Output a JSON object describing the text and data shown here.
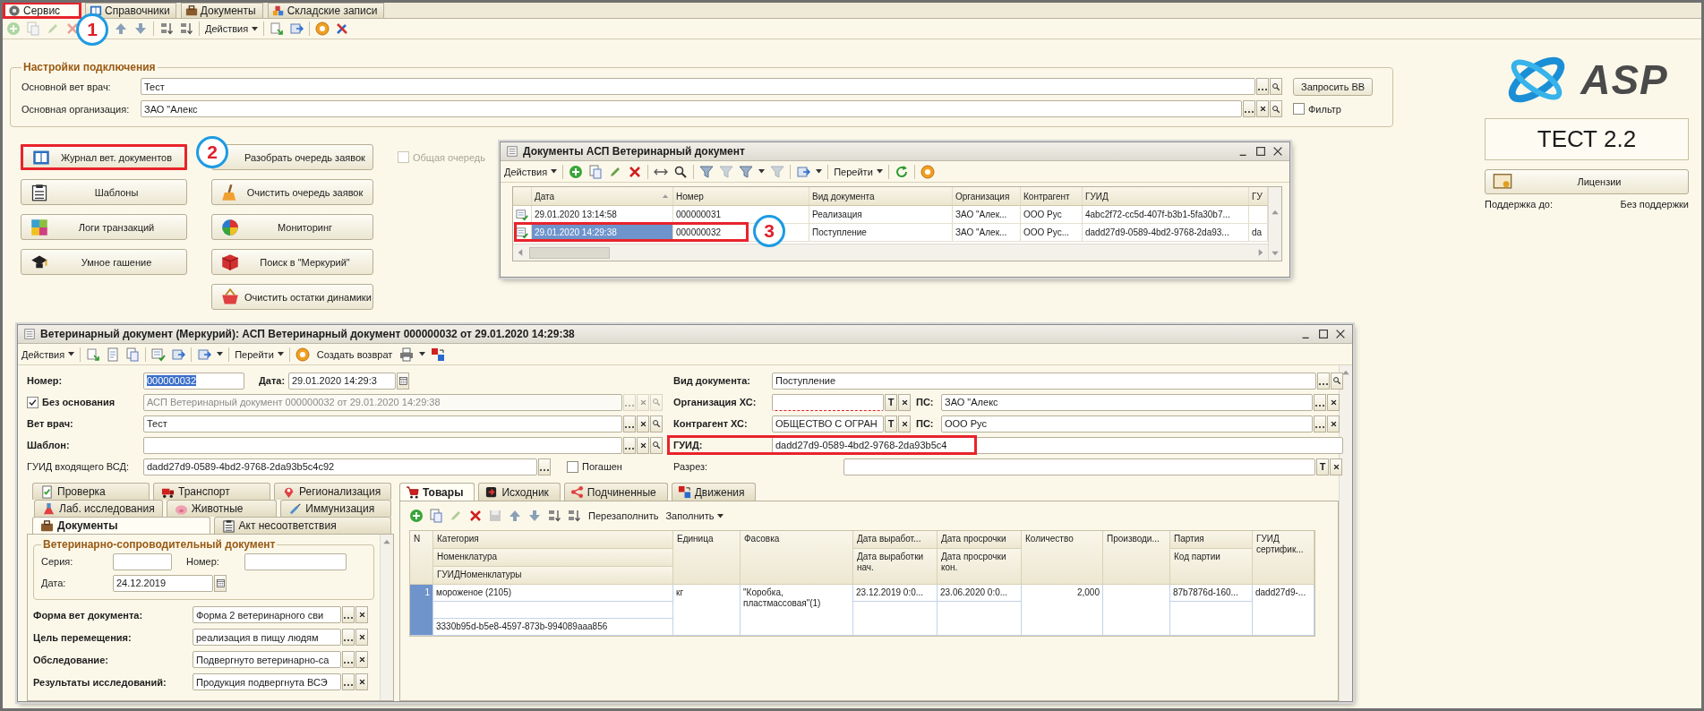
{
  "app_tabs": [
    {
      "label": "Сервис",
      "selected": true,
      "highlighted": true
    },
    {
      "label": "Справочники",
      "selected": false,
      "highlighted": false
    },
    {
      "label": "Документы",
      "selected": false,
      "highlighted": false
    },
    {
      "label": "Складские записи",
      "selected": false,
      "highlighted": false
    }
  ],
  "toolbar": {
    "actions_menu": "Действия"
  },
  "connection_settings": {
    "title": "Настройки подключения",
    "fields": [
      {
        "label": "Основной вет врач:",
        "value": "Тест"
      },
      {
        "label": "Основная организация:",
        "value": "ЗАО \"Алекс"
      }
    ],
    "request_button": "Запросить ВВ",
    "filter": {
      "label": "Фильтр",
      "checked": false
    }
  },
  "service_buttons": [
    {
      "label": "Журнал вет. документов",
      "highlighted": true
    },
    {
      "label": "Шаблоны",
      "highlighted": false
    },
    {
      "label": "Логи транзакций",
      "highlighted": false
    },
    {
      "label": "Умное гашение",
      "highlighted": false
    }
  ],
  "queue_buttons": [
    {
      "label": "Разобрать очередь заявок"
    },
    {
      "label": "Очистить очередь заявок"
    },
    {
      "label": "Мониторинг"
    },
    {
      "label": "Поиск в \"Меркурий\""
    },
    {
      "label": "Очистить остатки динамики"
    }
  ],
  "common_queue": {
    "label": "Общая очередь",
    "checked": false,
    "disabled": true
  },
  "brand": {
    "logo_text": "ASP",
    "edition": "ТЕСТ 2.2",
    "licenses_button": "Лицензии",
    "support_label": "Поддержка до:",
    "support_value": "Без поддержки"
  },
  "docs_window": {
    "title": "Документы АСП Ветеринарный документ",
    "actions_menu": "Действия",
    "goto_menu": "Перейти",
    "columns": [
      "Дата",
      "Номер",
      "Вид документа",
      "Организация",
      "Контрагент",
      "ГУИД",
      "ГУ"
    ],
    "rows": [
      {
        "cells": [
          "29.01.2020 13:14:58",
          "000000031",
          "Реализация",
          "ЗАО \"Алек...",
          "ООО Рус",
          "4abc2f72-cc5d-407f-b3b1-5fa30b7..."
        ],
        "selected": false,
        "highlighted": false
      },
      {
        "cells": [
          "29.01.2020 14:29:38",
          "000000032",
          "Поступление",
          "ЗАО \"Алек...",
          "ООО Рус...",
          "dadd27d9-0589-4bd2-9768-2da93...",
          "da"
        ],
        "selected": true,
        "highlighted": true
      }
    ]
  },
  "markers": [
    "1",
    "2",
    "3"
  ],
  "vet_window": {
    "title": "Ветеринарный документ (Меркурий): АСП Ветеринарный документ 000000032 от 29.01.2020 14:29:38",
    "actions_menu": "Действия",
    "goto_menu": "Перейти",
    "return_button": "Создать возврат",
    "header": {
      "number": {
        "label": "Номер:",
        "value": "000000032"
      },
      "date": {
        "label": "Дата:",
        "value": "29.01.2020 14:29:3"
      },
      "no_basis": {
        "label": "Без основания",
        "checked": true,
        "value": "АСП Ветеринарный документ 000000032 от 29.01.2020 14:29:38"
      },
      "vet": {
        "label": "Вет врач:",
        "value": "Тест"
      },
      "template": {
        "label": "Шаблон:"
      },
      "incoming_guid": {
        "label": "ГУИД входящего ВСД:",
        "value": "dadd27d9-0589-4bd2-9768-2da93b5c4c92"
      },
      "redeemed": {
        "label": "Погашен",
        "checked": false
      },
      "doc_type": {
        "label": "Вид документа:",
        "value": "Поступление"
      },
      "org": {
        "label": "Организация ХС:",
        "type_button": "T",
        "required": true
      },
      "org_ps": {
        "label": "ПС:",
        "value": "ЗАО \"Алекс"
      },
      "contractor": {
        "label": "Контрагент ХС:",
        "value": "ОБЩЕСТВО С ОГРАН",
        "type_button": "T"
      },
      "contractor_ps": {
        "label": "ПС:",
        "value": "ООО Рус"
      },
      "guid": {
        "label": "ГУИД:",
        "value": "dadd27d9-0589-4bd2-9768-2da93b5c4",
        "highlighted": true
      },
      "section": {
        "label": "Разрез:",
        "type_button": "T"
      }
    },
    "left_tabs": [
      [
        {
          "label": "Проверка",
          "selected": false
        },
        {
          "label": "Транспорт",
          "selected": false
        },
        {
          "label": "Регионализация",
          "selected": false
        }
      ],
      [
        {
          "label": "Лаб. исследования",
          "selected": false
        },
        {
          "label": "Животные",
          "selected": false
        },
        {
          "label": "Иммунизация",
          "selected": false
        }
      ],
      [
        {
          "label": "Документы",
          "selected": true
        },
        {
          "label": "Акт несоответствия",
          "selected": false
        }
      ]
    ],
    "vsd_group": {
      "title": "Ветеринарно-сопроводительный документ",
      "series_label": "Серия:",
      "number_label": "Номер:",
      "date_label": "Дата:",
      "date": "24.12.2019"
    },
    "vsd_fields": [
      {
        "label": "Форма вет документа:",
        "value": "Форма 2 ветеринарного сви"
      },
      {
        "label": "Цель перемещения:",
        "value": "реализация в пищу людям"
      },
      {
        "label": "Обследование:",
        "value": "Подвергнуто ветеринарно-са"
      },
      {
        "label": "Результаты исследований:",
        "value": "Продукция подвергнута ВСЭ"
      }
    ],
    "right_tabs": [
      {
        "label": "Товары",
        "selected": true
      },
      {
        "label": "Исходник",
        "selected": false
      },
      {
        "label": "Подчиненные",
        "selected": false
      },
      {
        "label": "Движения",
        "selected": false
      }
    ],
    "goods_toolbar": {
      "refill": "Перезаполнить",
      "fill_menu": "Заполнить"
    },
    "goods_table": {
      "columns": [
        {
          "label": "N"
        },
        {
          "label": "Категория",
          "sublabels": [
            "Номенклатура",
            "ГУИДНоменклатуры"
          ]
        },
        {
          "label": "Единица"
        },
        {
          "label": "Фасовка"
        },
        {
          "label": "Дата выработ...",
          "sublabels": [
            "Дата выработки нач."
          ]
        },
        {
          "label": "Дата просрочки",
          "sublabels": [
            "Дата просрочки кон."
          ]
        },
        {
          "label": "Количество"
        },
        {
          "label": "Производи..."
        },
        {
          "label": "Партия",
          "sublabels": [
            "Код партии"
          ]
        },
        {
          "label": "ГУИД сертифик..."
        }
      ],
      "rows": [
        {
          "selected": true,
          "n": "1",
          "category": "мороженое (2105)",
          "nomenclature_guid": "3330b95d-b5e8-4597-873b-994089aaa856",
          "unit": "кг",
          "packing": "\"Коробка, пластмассовая\"(1)",
          "production_date": "23.12.2019 0:0...",
          "expiry_date": "23.06.2020 0:0...",
          "quantity": "2,000",
          "batch": "87b7876d-160...",
          "certificate_guid": "dadd27d9-..."
        }
      ]
    }
  }
}
